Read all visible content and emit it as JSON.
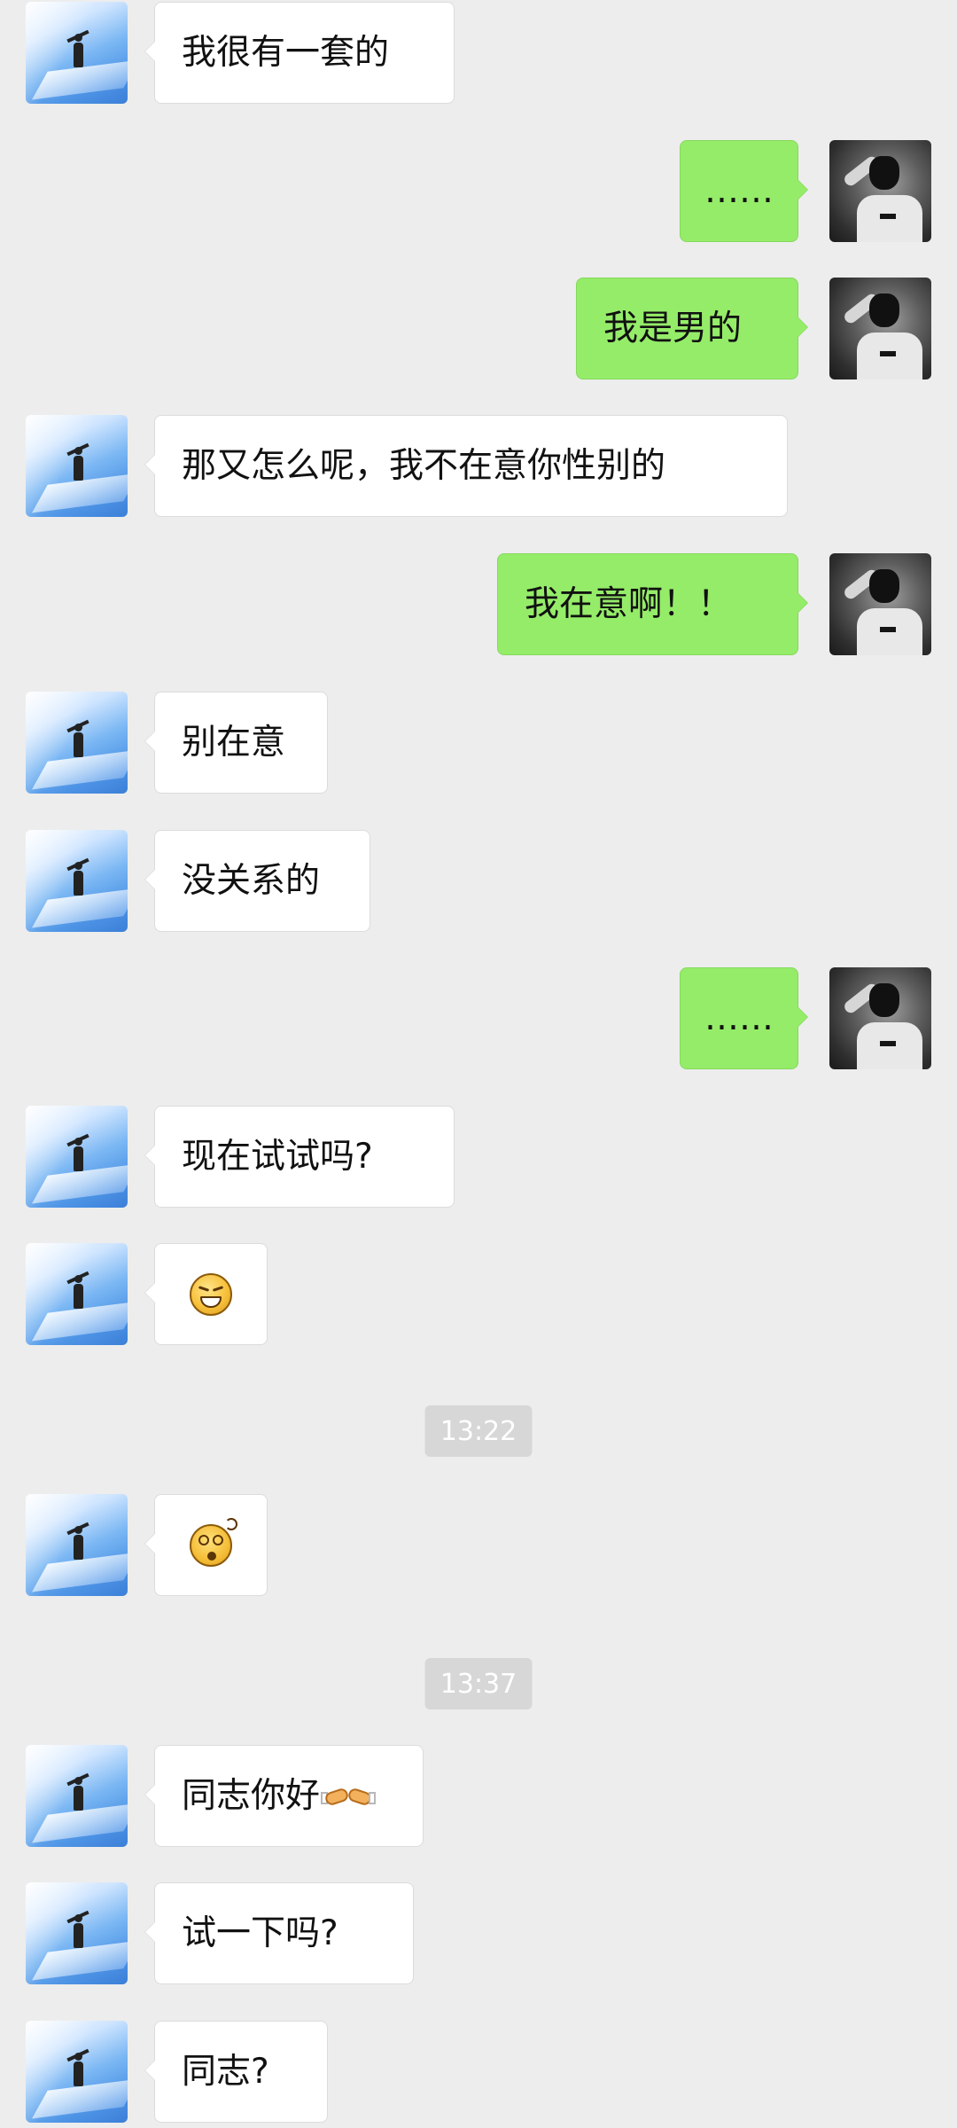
{
  "messages": [
    {
      "sender": "other",
      "text": "我很有一套的"
    },
    {
      "sender": "me",
      "text": "……"
    },
    {
      "sender": "me",
      "text": "我是男的"
    },
    {
      "sender": "other",
      "text": "那又怎么呢，我不在意你性别的"
    },
    {
      "sender": "me",
      "text": "我在意啊！！"
    },
    {
      "sender": "other",
      "text": "别在意"
    },
    {
      "sender": "other",
      "text": "没关系的"
    },
    {
      "sender": "me",
      "text": "……"
    },
    {
      "sender": "other",
      "text": "现在试试吗?"
    },
    {
      "sender": "other",
      "emoji": "grinning-face"
    },
    {
      "timestamp": "13:22"
    },
    {
      "sender": "other",
      "emoji": "dizzy-face"
    },
    {
      "timestamp": "13:37"
    },
    {
      "sender": "other",
      "text": "同志你好",
      "emoji": "handshake"
    },
    {
      "sender": "other",
      "text": "试一下吗?"
    },
    {
      "sender": "other",
      "text": "同志?"
    }
  ],
  "colors": {
    "background": "#ededed",
    "self_bubble": "#95ec69",
    "other_bubble": "#ffffff",
    "timestamp_bg": "#d7d7d7",
    "timestamp_text": "#ffffff"
  },
  "icons": {
    "other_avatar": "sky-figure-avatar",
    "self_avatar": "grayscale-portrait-avatar"
  }
}
